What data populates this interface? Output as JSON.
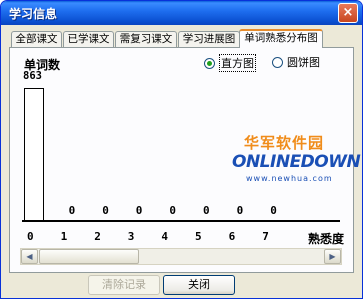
{
  "window": {
    "title": "学习信息",
    "close_glyph": "×"
  },
  "tabs": [
    {
      "label": "全部课文",
      "active": false
    },
    {
      "label": "已学课文",
      "active": false
    },
    {
      "label": "需复习课文",
      "active": false
    },
    {
      "label": "学习进展图",
      "active": false
    },
    {
      "label": "单词熟悉分布图",
      "active": true
    }
  ],
  "view_options": [
    {
      "label": "直方图",
      "checked": true
    },
    {
      "label": "圆饼图",
      "checked": false
    }
  ],
  "chart_data": {
    "type": "bar",
    "title": "",
    "ylabel": "单词数",
    "xlabel": "熟悉度",
    "y_max_label": "863",
    "categories": [
      "0",
      "1",
      "2",
      "3",
      "4",
      "5",
      "6",
      "7"
    ],
    "values": [
      863,
      0,
      0,
      0,
      0,
      0,
      0,
      0
    ],
    "value_labels": [
      "",
      "0",
      "0",
      "0",
      "0",
      "0",
      "0",
      "0"
    ],
    "ylim": [
      0,
      863
    ],
    "grid": false,
    "legend": "none"
  },
  "watermark": {
    "line1": "华军软件园",
    "line2": "ONLINEDOWN",
    "line3": "www.newhua.com"
  },
  "scrollbar": {
    "left_arrow": "◀",
    "right_arrow": "▶"
  },
  "buttons": {
    "clear": {
      "label": "清除记录",
      "enabled": false
    },
    "close": {
      "label": "关闭",
      "enabled": true
    }
  }
}
